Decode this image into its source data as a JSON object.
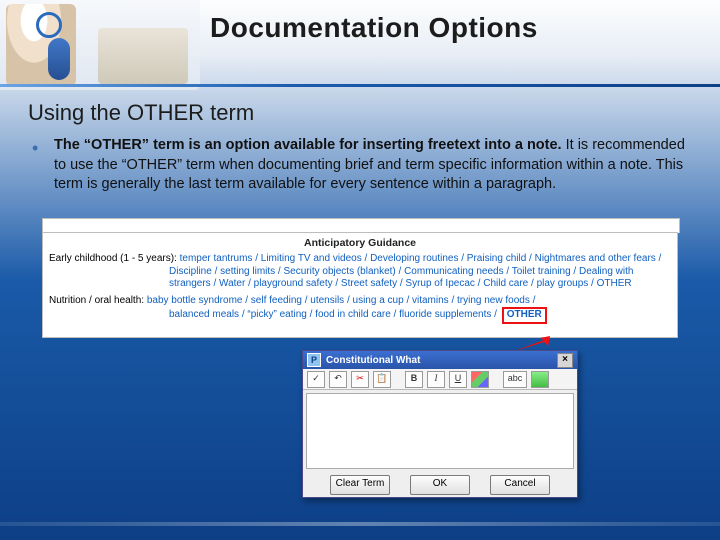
{
  "title": "Documentation Options",
  "subhead": "Using the OTHER term",
  "bullet": {
    "bold": "The “OTHER” term is an option available for inserting freetext into a note.",
    "rest": " It is recommended to use the “OTHER” term when documenting brief and term specific information within a note. This term is generally the last term available for every sentence within a paragraph."
  },
  "panel": {
    "header": "Anticipatory Guidance",
    "row1_label": "Early childhood (1 - 5 years):",
    "row1_opts_a": "temper tantrums / Limiting TV and videos / Developing routines / Praising child / Nightmares and other fears /",
    "row1_opts_b": "Discipline / setting limits / Security objects (blanket) / Communicating needs / Toilet training / Dealing with strangers / Water / playground safety / Street safety / Syrup of Ipecac / Child care / play groups / OTHER",
    "row2_label": "Nutrition / oral health:",
    "row2_opts_a": "baby bottle syndrome / self feeding / utensils / using a cup / vitamins / trying new foods /",
    "row2_opts_b": "balanced meals / “picky” eating / food in child care / fluoride supplements /",
    "other": "OTHER"
  },
  "dialog": {
    "title": "Constitutional   What",
    "icon_letter": "P",
    "toolbar": {
      "check": "✓",
      "undo": "↶",
      "cut": "✂",
      "paste": "📋",
      "bold": "B",
      "italic": "I",
      "underline": "U",
      "color": "",
      "spell": "abc",
      "record": ""
    },
    "buttons": {
      "clear": "Clear Term",
      "ok": "OK",
      "cancel": "Cancel"
    },
    "close": "×"
  }
}
